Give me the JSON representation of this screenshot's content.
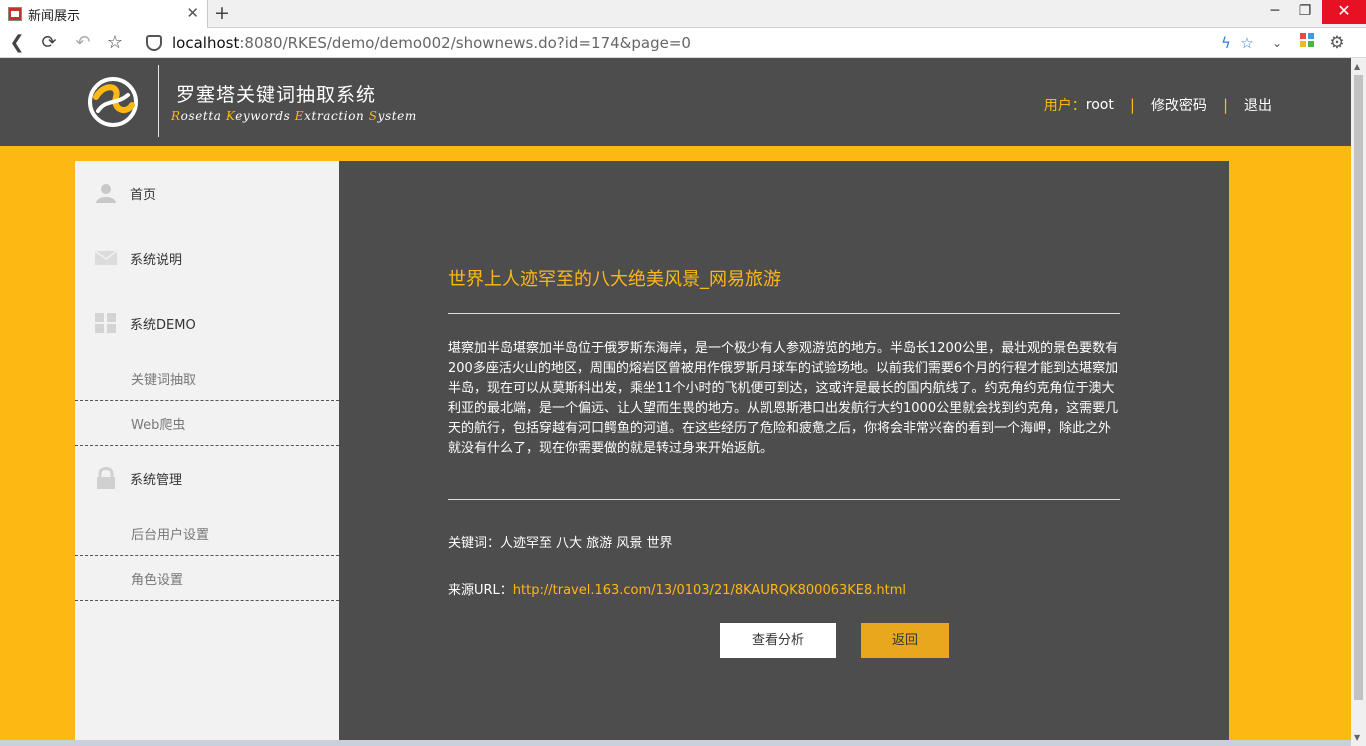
{
  "browser": {
    "tab_title": "新闻展示",
    "url_host": "localhost",
    "url_rest": ":8080/RKES/demo/demo002/shownews.do?id=174&page=0"
  },
  "header": {
    "title": "罗塞塔关键词抽取系统",
    "subtitle_parts": [
      {
        "accent": "R",
        "rest": "osetta "
      },
      {
        "accent": "K",
        "rest": "eywords "
      },
      {
        "accent": "E",
        "rest": "xtraction "
      },
      {
        "accent": "S",
        "rest": "ystem"
      }
    ],
    "user_label": "用户：",
    "user_name": "root",
    "change_password": "修改密码",
    "logout": "退出",
    "separator": "|"
  },
  "sidebar": {
    "home": "首页",
    "intro": "系统说明",
    "demo": "系统DEMO",
    "demo_items": [
      "关键词抽取",
      "Web爬虫"
    ],
    "admin": "系统管理",
    "admin_items": [
      "后台用户设置",
      "角色设置"
    ]
  },
  "article": {
    "title": "世界上人迹罕至的八大绝美风景_网易旅游",
    "body": "堪察加半岛堪察加半岛位于俄罗斯东海岸，是一个极少有人参观游览的地方。半岛长1200公里，最壮观的景色要数有200多座活火山的地区，周围的熔岩区曾被用作俄罗斯月球车的试验场地。以前我们需要6个月的行程才能到达堪察加半岛，现在可以从莫斯科出发，乘坐11个小时的飞机便可到达，这或许是最长的国内航线了。约克角约克角位于澳大利亚的最北端，是一个偏远、让人望而生畏的地方。从凯恩斯港口出发航行大约1000公里就会找到约克角，这需要几天的航行，包括穿越有河口鳄鱼的河道。在这些经历了危险和疲惫之后，你将会非常兴奋的看到一个海岬，除此之外就没有什么了，现在你需要做的就是转过身来开始返航。",
    "keywords_label": "关键词：",
    "keywords": "人迹罕至 八大 旅游 风景 世界",
    "source_label": "来源URL：",
    "source_url": "http://travel.163.com/13/0103/21/8KAURQK800063KE8.html",
    "analyze_button": "查看分析",
    "back_button": "返回"
  }
}
